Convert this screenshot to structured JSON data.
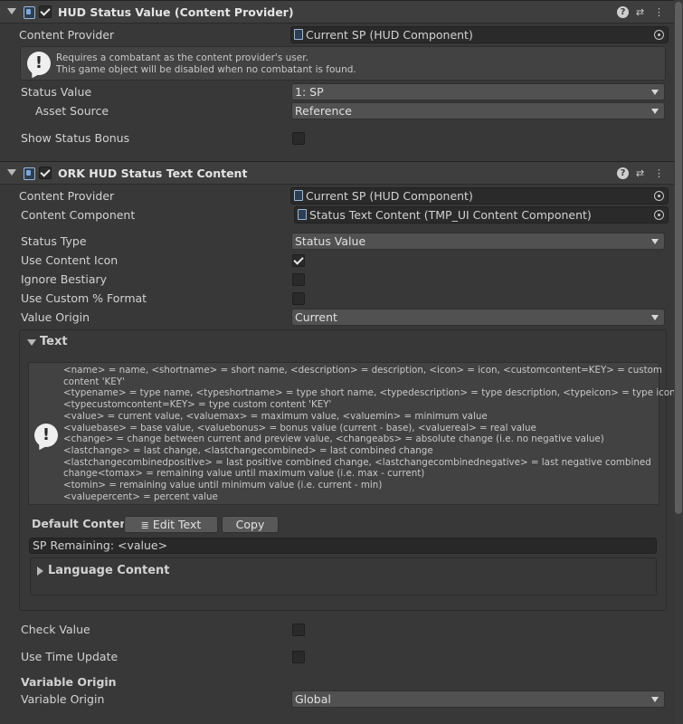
{
  "component1": {
    "title": "HUD Status Value (Content Provider)",
    "content_provider_label": "Content Provider",
    "content_provider_value": "Current SP (HUD Component)",
    "help_line1": "Requires a combatant as the content provider's user.",
    "help_line2": "This game object will be disabled when no combatant is found.",
    "status_value_label": "Status Value",
    "status_value_value": "1: SP",
    "asset_source_label": "Asset Source",
    "asset_source_value": "Reference",
    "show_status_bonus_label": "Show Status Bonus"
  },
  "component2": {
    "title": "ORK HUD Status Text Content",
    "content_provider_label": "Content Provider",
    "content_provider_value": "Current SP (HUD Component)",
    "content_component_label": "Content Component",
    "content_component_value": "Status Text Content (TMP_UI Content Component)",
    "status_type_label": "Status Type",
    "status_type_value": "Status Value",
    "use_content_icon_label": "Use Content Icon",
    "ignore_bestiary_label": "Ignore Bestiary",
    "use_custom_format_label": "Use Custom % Format",
    "value_origin_label": "Value Origin",
    "value_origin_value": "Current",
    "text_section_label": "Text",
    "help_lines": [
      "<name> = name, <shortname> = short name, <description> = description, <icon> = icon, <customcontent=KEY> = custom",
      "content 'KEY'",
      "<typename> = type name, <typeshortname> = type short name, <typedescription> = type description, <typeicon> = type icon,",
      "<typecustomcontent=KEY> = type custom content 'KEY'",
      "<value> = current value, <valuemax> = maximum value, <valuemin> = minimum value",
      "<valuebase> = base value, <valuebonus> = bonus value (current - base), <valuereal> = real value",
      "<change> = change between current and preview value, <changeabs> = absolute change (i.e. no negative value)",
      "<lastchange> = last change, <lastchangecombined> = last combined change",
      "<lastchangecombinedpositive> = last positive combined change, <lastchangecombinednegative> = last negative combined",
      "change<tomax> = remaining value until maximum value (i.e. max - current)",
      "<tomin> = remaining value until minimum value (i.e. current - min)",
      "<valuepercent> = percent value"
    ],
    "default_content_label": "Default Content",
    "edit_text_label": "Edit Text",
    "copy_label": "Copy",
    "default_content_value": "SP Remaining: <value>",
    "language_content_label": "Language Content",
    "check_value_label": "Check Value",
    "use_time_update_label": "Use Time Update",
    "variable_origin_header": "Variable Origin",
    "variable_origin_label": "Variable Origin",
    "variable_origin_value": "Global"
  },
  "icons": [
    "fold-arrow-icon",
    "component-icon",
    "help-icon",
    "preset-icon",
    "more-icon",
    "object-picker-icon",
    "warning-icon",
    "dropdown-arrow-icon",
    "edit-text-icon"
  ]
}
